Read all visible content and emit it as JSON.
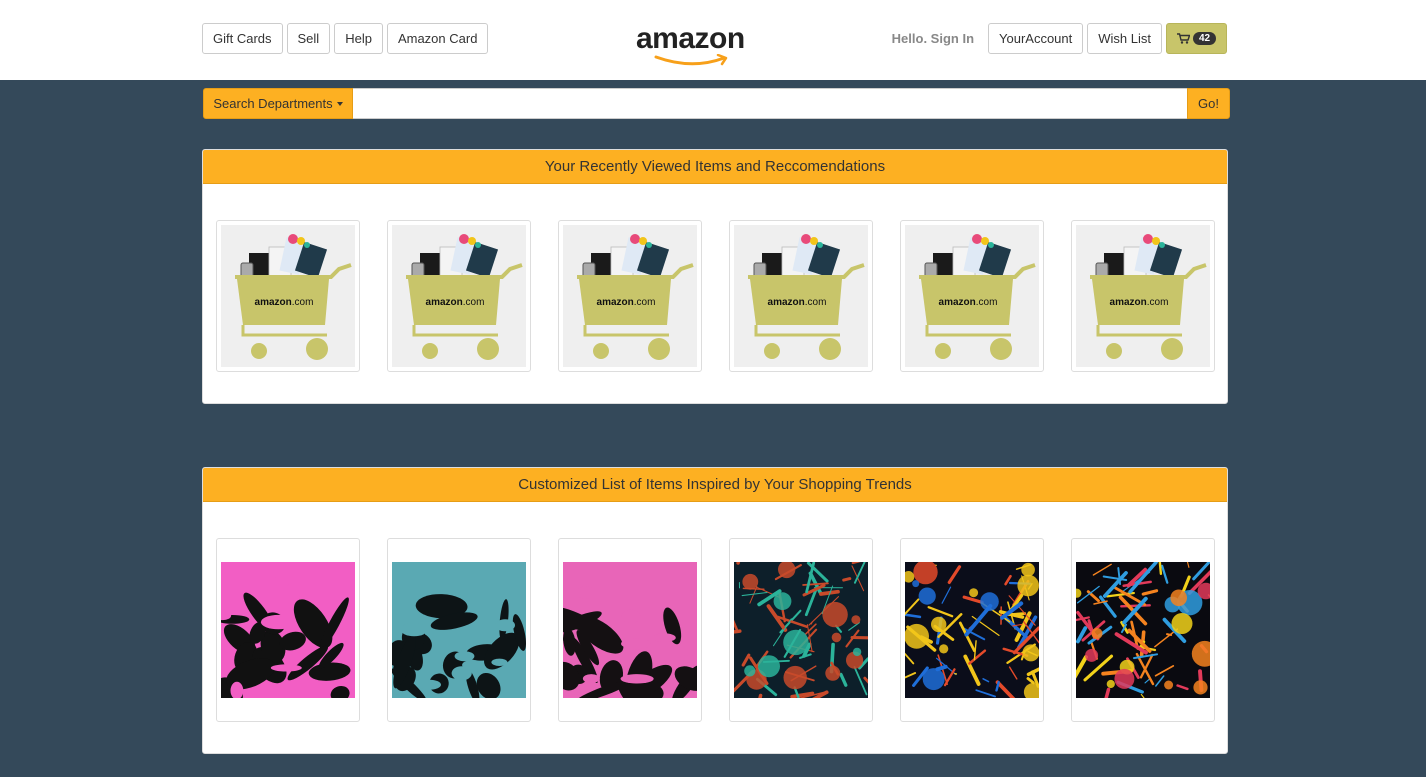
{
  "nav": {
    "left_buttons": [
      "Gift Cards",
      "Sell",
      "Help",
      "Amazon Card"
    ],
    "hello": "Hello. Sign In",
    "account": "YourAccount",
    "wishlist": "Wish List",
    "cart_count": "42",
    "logo_text": "amazon"
  },
  "search": {
    "department_label": "Search Departments",
    "value": "",
    "go_label": "Go!"
  },
  "recent": {
    "heading": "Your Recently Viewed Items and Reccomendations",
    "items": [
      {
        "image": "amazon-cart-giftcards"
      },
      {
        "image": "amazon-cart-giftcards"
      },
      {
        "image": "amazon-cart-giftcards"
      },
      {
        "image": "amazon-cart-giftcards"
      },
      {
        "image": "amazon-cart-giftcards"
      },
      {
        "image": "amazon-cart-giftcards"
      }
    ],
    "cart_label": "amazon.com"
  },
  "custom": {
    "heading": "Customized List of Items Inspired by Your Shopping Trends",
    "items": [
      {
        "image": "abstract-leaves-pink",
        "colors": [
          "#f25ec4",
          "#111111"
        ]
      },
      {
        "image": "abstract-leaves-teal",
        "colors": [
          "#5aa9b3",
          "#0d1416"
        ]
      },
      {
        "image": "abstract-leaves-pink-dark",
        "colors": [
          "#e865b8",
          "#141012"
        ]
      },
      {
        "image": "abstract-splatter-green",
        "colors": [
          "#2bb39a",
          "#c84a2a",
          "#0d1f2a"
        ]
      },
      {
        "image": "abstract-splatter-rainbow",
        "colors": [
          "#f2c51a",
          "#1f6ed9",
          "#e44a2a",
          "#0b0d1a"
        ]
      },
      {
        "image": "abstract-splatter-sunset",
        "colors": [
          "#f5831f",
          "#f2d21a",
          "#2f9de0",
          "#e23a5a",
          "#0a0a10"
        ]
      }
    ]
  },
  "colors": {
    "accent": "#fdb022",
    "background": "#34495a",
    "cart_olive": "#c8c56a"
  }
}
